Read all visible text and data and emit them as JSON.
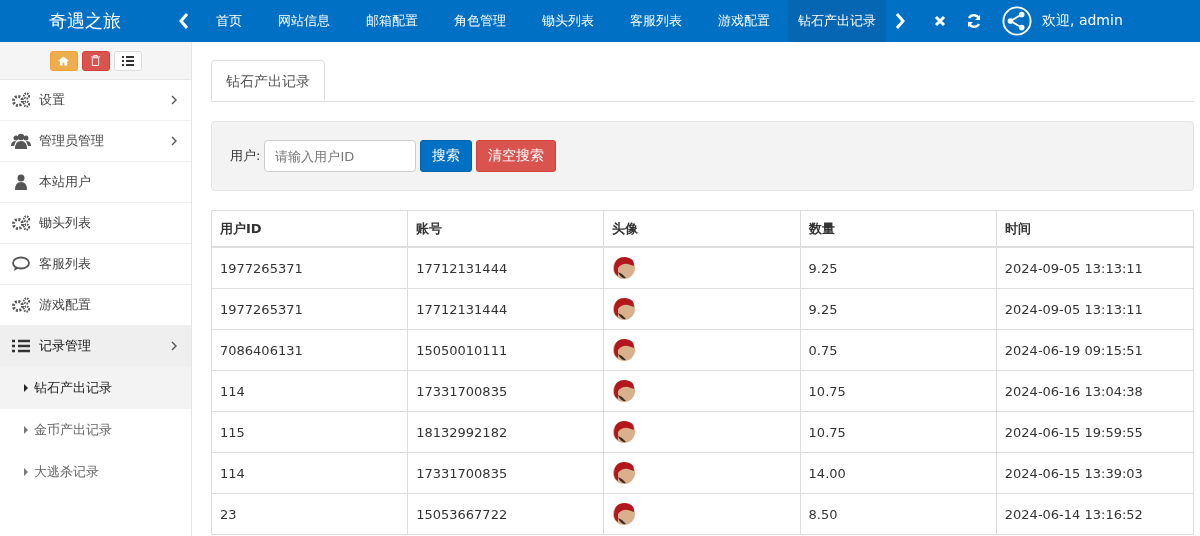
{
  "header": {
    "logo": "奇遇之旅",
    "tabs": [
      {
        "label": "首页",
        "selected": false
      },
      {
        "label": "网站信息",
        "selected": false
      },
      {
        "label": "邮箱配置",
        "selected": false
      },
      {
        "label": "角色管理",
        "selected": false
      },
      {
        "label": "锄头列表",
        "selected": false
      },
      {
        "label": "客服列表",
        "selected": false
      },
      {
        "label": "游戏配置",
        "selected": false
      },
      {
        "label": "钻石产出记录",
        "selected": true
      }
    ],
    "user": "欢迎, admin"
  },
  "sidebar": {
    "items": [
      {
        "label": "设置",
        "kind": "gears",
        "expanded": false,
        "has_children": true
      },
      {
        "label": "管理员管理",
        "kind": "users",
        "expanded": false,
        "has_children": true
      },
      {
        "label": "本站用户",
        "kind": "user",
        "expanded": false,
        "has_children": false
      },
      {
        "label": "锄头列表",
        "kind": "gears",
        "expanded": false,
        "has_children": false
      },
      {
        "label": "客服列表",
        "kind": "chat",
        "expanded": false,
        "has_children": false
      },
      {
        "label": "游戏配置",
        "kind": "gears",
        "expanded": false,
        "has_children": false
      },
      {
        "label": "记录管理",
        "kind": "list",
        "expanded": true,
        "has_children": true,
        "children": [
          {
            "label": "钻石产出记录",
            "selected": true
          },
          {
            "label": "金币产出记录",
            "selected": false
          },
          {
            "label": "大逃杀记录",
            "selected": false
          }
        ]
      }
    ]
  },
  "page_tab": "钻石产出记录",
  "search": {
    "label": "用户:",
    "placeholder": "请输入用户ID",
    "buttons": [
      {
        "label": "搜索",
        "kind": "primary"
      },
      {
        "label": "清空搜索",
        "kind": "danger"
      }
    ]
  },
  "table": {
    "columns": [
      "用户ID",
      "账号",
      "头像",
      "数量",
      "时间"
    ],
    "rows": [
      [
        "1977265371",
        "17712131444",
        "",
        "9.25",
        "2024-09-05 13:13:11"
      ],
      [
        "1977265371",
        "17712131444",
        "",
        "9.25",
        "2024-09-05 13:13:11"
      ],
      [
        "7086406131",
        "15050010111",
        "",
        "0.75",
        "2024-06-19 09:15:51"
      ],
      [
        "114",
        "17331700835",
        "",
        "10.75",
        "2024-06-16 13:04:38"
      ],
      [
        "115",
        "18132992182",
        "",
        "10.75",
        "2024-06-15 19:59:55"
      ],
      [
        "114",
        "17331700835",
        "",
        "14.00",
        "2024-06-15 13:39:03"
      ],
      [
        "23",
        "15053667722",
        "",
        "8.50",
        "2024-06-14 13:16:52"
      ]
    ]
  }
}
